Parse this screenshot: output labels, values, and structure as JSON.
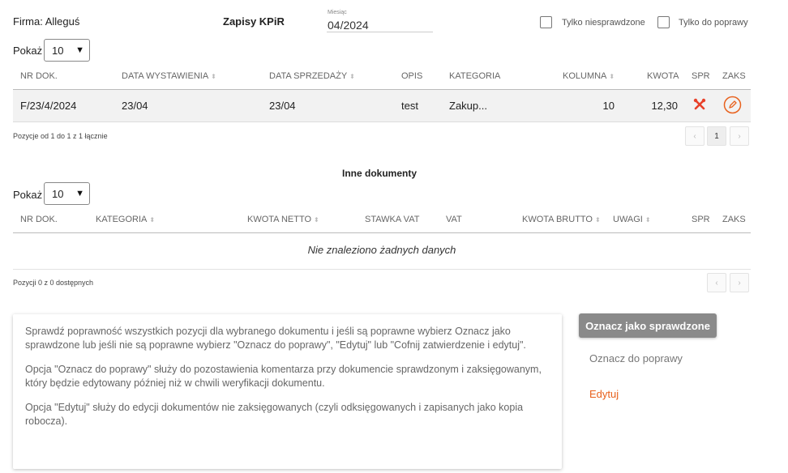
{
  "header": {
    "firma": "Firma: Alleguś",
    "title": "Zapisy KPiR",
    "month_label": "Miesiąc",
    "month_value": "04/2024",
    "filter_unchecked_label": "Tylko niesprawdzone",
    "filter_fix_label": "Tylko do poprawy"
  },
  "kpir": {
    "show_label": "Pokaż",
    "show_value": "10",
    "columns": {
      "nr": "NR DOK.",
      "data_wyst": "DATA WYSTAWIENIA",
      "data_sprz": "DATA SPRZEDAŻY",
      "opis": "OPIS",
      "kategoria": "KATEGORIA",
      "kolumna": "KOLUMNA",
      "kwota": "KWOTA",
      "spr": "SPR",
      "zaks": "ZAKS"
    },
    "rows": [
      {
        "nr": "F/23/4/2024",
        "data_wyst": "23/04",
        "data_sprz": "23/04",
        "opis": "test",
        "kategoria": "Zakup...",
        "kolumna": "10",
        "kwota": "12,30",
        "spr_icon": "wrench-screwdriver-icon",
        "zaks_icon": "pencil-icon"
      }
    ],
    "info": "Pozycje od 1 do 1 z 1 łącznie",
    "pagination": {
      "prev": "‹",
      "page": "1",
      "next": "›"
    }
  },
  "other": {
    "title": "Inne dokumenty",
    "show_label": "Pokaż",
    "show_value": "10",
    "columns": {
      "nr": "NR DOK.",
      "kategoria": "KATEGORIA",
      "netto": "KWOTA NETTO",
      "stawka": "STAWKA VAT",
      "vat": "VAT",
      "brutto": "KWOTA BRUTTO",
      "uwagi": "UWAGI",
      "spr": "SPR",
      "zaks": "ZAKS"
    },
    "empty": "Nie znaleziono żadnych danych",
    "info": "Pozycji 0 z 0 dostępnych",
    "pagination": {
      "prev": "‹",
      "next": "›"
    }
  },
  "help": {
    "p1": "Sprawdź poprawność wszystkich pozycji dla wybranego dokumentu i jeśli są poprawne wybierz Oznacz jako sprawdzone lub jeśli nie są poprawne wybierz \"Oznacz do poprawy\", \"Edytuj\" lub \"Cofnij zatwierdzenie i edytuj\".",
    "p2": "Opcja \"Oznacz do poprawy\" służy do pozostawienia komentarza przy dokumencie sprawdzonym i zaksięgowanym, który będzie edytowany później niż w chwili weryfikacji dokumentu.",
    "p3": "Opcja \"Edytuj\" służy do edycji dokumentów nie zaksięgowanych (czyli odksięgowanych i zapisanych jako kopia robocza)."
  },
  "actions": {
    "mark_checked": "Oznacz jako sprawdzone",
    "mark_fix": "Oznacz do poprawy",
    "edit": "Edytuj"
  },
  "colors": {
    "accent_orange": "#e8611d",
    "error_red": "#e8412a",
    "button_gray": "#8a8a8a"
  }
}
